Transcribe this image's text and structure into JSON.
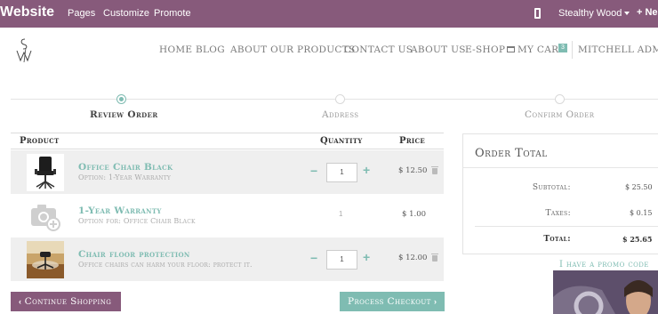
{
  "admin_bar": {
    "brand": "Website",
    "menu": [
      "Pages",
      "Customize",
      "Promote"
    ],
    "theme": "Stealthy Wood",
    "new_label": "+ Ne"
  },
  "site_nav": {
    "items": [
      "HOME",
      "BLOG",
      "ABOUT OUR PRODUCTS",
      "CONTACT US",
      "ABOUT US",
      "E-SHOP"
    ],
    "cart_label": "MY CART",
    "cart_count": "3",
    "user": "MITCHELL ADMIN"
  },
  "wizard": {
    "steps": [
      "Review Order",
      "Address",
      "Confirm Order"
    ],
    "active_step": 0
  },
  "cart": {
    "headers": {
      "product": "Product",
      "quantity": "Quantity",
      "price": "Price"
    },
    "rows": [
      {
        "name": "Office Chair Black",
        "desc": "Option: 1-Year Warranty",
        "qty": "1",
        "price": "$ 12.50",
        "editable": true
      },
      {
        "name": "1-Year Warranty",
        "desc": "Option for: Office Chair Black",
        "qty": "1",
        "price": "$ 1.00",
        "editable": false
      },
      {
        "name": "Chair floor protection",
        "desc": "Office chairs can harm your floor: protect it.",
        "qty": "1",
        "price": "$ 12.00",
        "editable": true
      }
    ],
    "continue_label": "Continue Shopping",
    "checkout_label": "Process Checkout"
  },
  "order_total": {
    "title": "Order Total",
    "subtotal_label": "Subtotal:",
    "subtotal": "$ 25.50",
    "taxes_label": "Taxes:",
    "taxes": "$ 0.15",
    "total_label": "Total:",
    "total": "$ 25.65",
    "promo_label": "I have a promo code"
  },
  "colors": {
    "brand": "#875a7b",
    "accent": "#7fbcb2"
  }
}
